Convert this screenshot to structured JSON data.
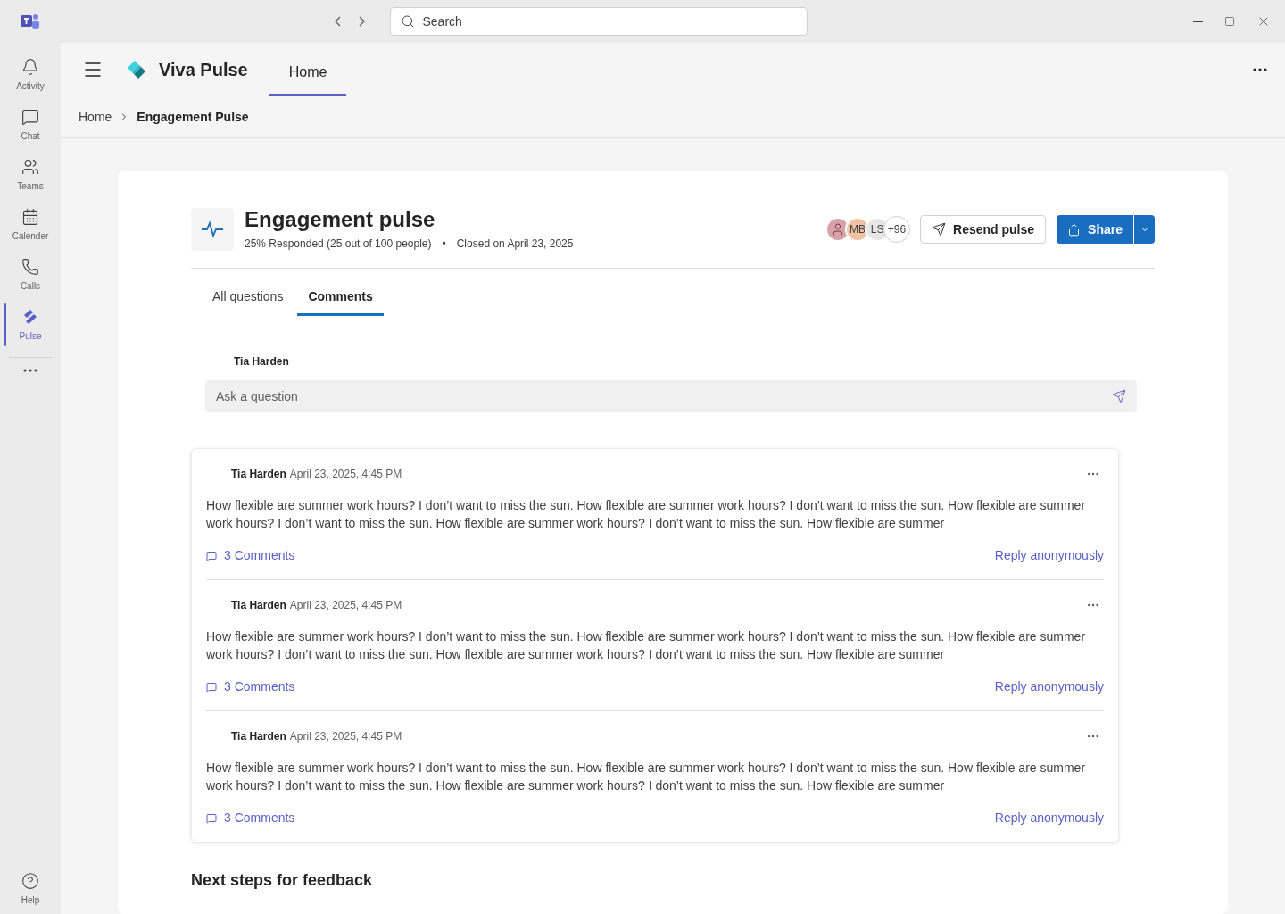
{
  "titlebar": {
    "search": {
      "placeholder": "Search"
    }
  },
  "rail": {
    "items": [
      {
        "label": "Activity",
        "selected": false
      },
      {
        "label": "Chat",
        "selected": false
      },
      {
        "label": "Teams",
        "selected": false
      },
      {
        "label": "Calender",
        "selected": false
      },
      {
        "label": "Calls",
        "selected": false
      },
      {
        "label": "Pulse",
        "selected": true
      }
    ],
    "help": "Help"
  },
  "app_header": {
    "app_name": "Viva Pulse",
    "tabs": [
      {
        "label": "Home",
        "selected": true
      }
    ]
  },
  "breadcrumb": [
    "Home",
    "Engagement Pulse"
  ],
  "pulse": {
    "title": "Engagement pulse",
    "responded": "25% Responded (25 out of 100 people)",
    "separator": "•",
    "closed": "Closed on April 23, 2025",
    "avatars": [
      {
        "kind": "icon",
        "color": "#d7a3ab"
      },
      {
        "kind": "initials",
        "text": "MB",
        "color": "#efc3a4"
      },
      {
        "kind": "initials",
        "text": "LS",
        "color": "#e6e6e6"
      },
      {
        "kind": "count",
        "text": "+96",
        "color": "#ffffff"
      }
    ],
    "resend_button": "Resend pulse",
    "share_button": "Share"
  },
  "tabs": [
    {
      "label": "All questions",
      "selected": false
    },
    {
      "label": "Comments",
      "selected": true
    }
  ],
  "composer": {
    "author": "Tia Harden",
    "placeholder": "Ask a question"
  },
  "comments": [
    {
      "author": "Tia Harden",
      "time": "April 23, 2025, 4:45 PM",
      "text": "How flexible are summer work hours? I don’t want to miss the sun. How flexible are summer work hours? I don’t want to miss the sun. How flexible are summer work hours? I don’t want to miss the sun. How flexible are summer work hours? I don’t want to miss the sun. How flexible are summer",
      "comments_link": "3 Comments",
      "reply_link": "Reply anonymously"
    },
    {
      "author": "Tia Harden",
      "time": "April 23, 2025, 4:45 PM",
      "text": "How flexible are summer work hours? I don’t want to miss the sun. How flexible are summer work hours? I don’t want to miss the sun. How flexible are summer work hours? I don’t want to miss the sun. How flexible are summer work hours? I don’t want to miss the sun. How flexible are summer",
      "comments_link": "3 Comments",
      "reply_link": "Reply anonymously"
    },
    {
      "author": "Tia Harden",
      "time": "April 23, 2025, 4:45 PM",
      "text": "How flexible are summer work hours? I don’t want to miss the sun. How flexible are summer work hours? I don’t want to miss the sun. How flexible are summer work hours? I don’t want to miss the sun. How flexible are summer work hours? I don’t want to miss the sun. How flexible are summer",
      "comments_link": "3 Comments",
      "reply_link": "Reply anonymously"
    }
  ],
  "next_steps_heading": "Next steps for feedback"
}
